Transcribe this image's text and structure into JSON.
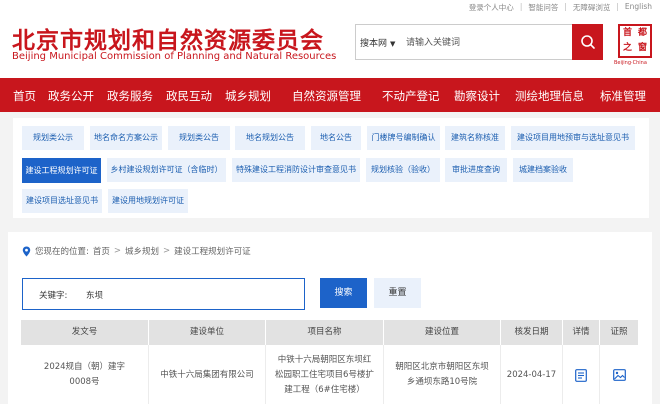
{
  "top_links": [
    "登录个人中心",
    "智能问答",
    "无障碍浏览",
    "English"
  ],
  "header": {
    "title_cn": "北京市规划和自然资源委员会",
    "title_en": "Beijing Municipal Commission of Planning and Natural Resources",
    "search_scope": "搜本网",
    "search_placeholder": "请输入关键词",
    "logo_chars": [
      "首",
      "都",
      "之",
      "窗"
    ],
    "logo_sub": "Beijing·China"
  },
  "nav": [
    "首页",
    "政务公开",
    "政务服务",
    "政民互动",
    "城乡规划",
    "自然资源管理",
    "不动产登记",
    "勘察设计",
    "测绘地理信息",
    "标准管理"
  ],
  "categories": [
    "规划类公示",
    "地名命名方案公示",
    "规划类公告",
    "地名规划公告",
    "地名公告",
    "门楼牌号编制确认",
    "建筑名称核准",
    "建设项目用地预审与选址意见书",
    "建设工程规划许可证",
    "乡村建设规划许可证（含临时）",
    "特殊建设工程消防设计审查意见书",
    "规划核验（验收）",
    "审批进度查询",
    "城建档案验收",
    "建设项目选址意见书",
    "建设用地规划许可证"
  ],
  "breadcrumb": {
    "label": "您现在的位置:",
    "items": [
      "首页",
      "城乡规划",
      "建设工程规划许可证"
    ]
  },
  "filter": {
    "label": "关键字:",
    "value": "东坝",
    "search_label": "搜索",
    "reset_label": "重置"
  },
  "table": {
    "headers": [
      "发文号",
      "建设单位",
      "项目名称",
      "建设位置",
      "核发日期",
      "详情",
      "证照"
    ],
    "rows": [
      {
        "doc_no": "2024规自（朝）建字0008号",
        "unit": "中铁十六局集团有限公司",
        "project": "中铁十六局朝阳区东坝红松园职工住宅项目6号楼扩建工程（6#住宅楼）",
        "location": "朝阳区北京市朝阳区东坝乡通坝东路10号院",
        "date": "2024-04-17"
      }
    ]
  },
  "colors": {
    "brand_red": "#c8161d",
    "accent_blue": "#1d63c9",
    "light_blue": "#eaf1fb"
  }
}
